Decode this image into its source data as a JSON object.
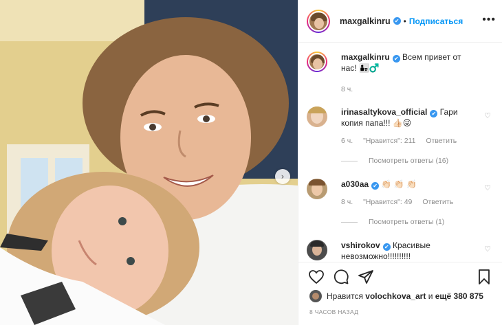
{
  "header": {
    "username": "maxgalkinru",
    "verified_mark": "✔",
    "separator": "•",
    "follow_label": "Подписаться",
    "more_icon": "•••"
  },
  "caption": {
    "username": "maxgalkinru",
    "text": "Всем привет от нас! 👨‍👧‍♂",
    "time": "8 ч."
  },
  "comments": [
    {
      "username": "irinasaltykova_official",
      "text": "Гари копия папа!!! 👍🏻😜",
      "time": "6 ч.",
      "likes": "\"Нравится\": 211",
      "reply_label": "Ответить",
      "view_replies": "Посмотреть ответы (16)"
    },
    {
      "username": "a030aa",
      "text": "👏🏻 👏🏻 👏🏻",
      "time": "8 ч.",
      "likes": "\"Нравится\": 49",
      "reply_label": "Ответить",
      "view_replies": "Посмотреть ответы (1)"
    },
    {
      "username": "vshirokov",
      "text": "Красивые невозможно!!!!!!!!!!"
    }
  ],
  "footer": {
    "liked_by_prefix": "Нравится",
    "liked_by_user": "volochkova_art",
    "liked_by_and": "и",
    "liked_by_others": "ещё 380 875",
    "time_ago": "8 ЧАСОВ НАЗАД"
  },
  "icons": {
    "like": "heart-outline",
    "comment": "speech-bubble",
    "share": "paper-plane",
    "save": "bookmark",
    "next": "chevron-right",
    "comment_like_glyph": "♡",
    "next_glyph": "›"
  },
  "colors": {
    "link_blue": "#0095f6",
    "verified_blue": "#3897f0",
    "muted": "#8e8e8e"
  }
}
